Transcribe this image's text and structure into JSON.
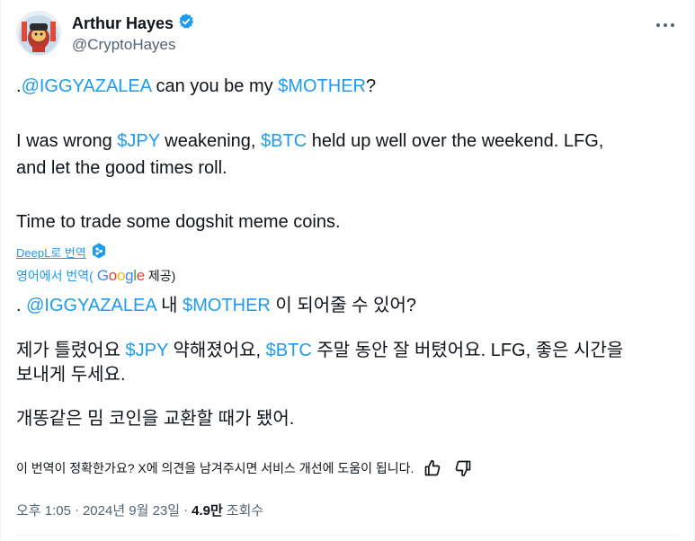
{
  "author": {
    "display_name": "Arthur Hayes",
    "handle": "@CryptoHayes",
    "verified_color": "#1d9bf0"
  },
  "tweet": {
    "line1": {
      "prefix": ".",
      "mention": "@IGGYAZALEA",
      "mid": " can you be my ",
      "ticker": "$MOTHER",
      "suffix": "?"
    },
    "line2": {
      "pre": "I was wrong ",
      "ticker1": "$JPY",
      "mid": " weakening, ",
      "ticker2": "$BTC",
      "post": " held up well over the weekend. LFG,"
    },
    "line3": "and let the good times roll.",
    "line4": "Time to trade some dogshit meme coins."
  },
  "deepl": {
    "label": "DeepL로 번역"
  },
  "translated_by": {
    "prefix": "영어에서 번역(",
    "provider": "Google",
    "suffix": " 제공)"
  },
  "translation": {
    "line1": {
      "prefix": ". ",
      "mention": "@IGGYAZALEA",
      "mid": " 내 ",
      "ticker": "$MOTHER",
      "suffix": " 이 되어줄 수 있어?"
    },
    "line2": {
      "pre": "제가 틀렸어요 ",
      "ticker1": "$JPY",
      "mid": " 약해졌어요, ",
      "ticker2": "$BTC",
      "post": " 주말 동안 잘 버텼어요. LFG, 좋은 시간을"
    },
    "line3": "보내게 두세요.",
    "line4": "개똥같은 밈 코인을 교환할 때가 됐어."
  },
  "feedback": {
    "question": "이 번역이 정확한가요? X에 의견을 남겨주시면 서비스 개선에 도움이 됩니다."
  },
  "meta": {
    "time": "오후 1:05",
    "sep": "·",
    "date": "2024년 9월 23일",
    "sep2": "·",
    "views": "4.9만",
    "views_label": "조회수"
  },
  "colors": {
    "link": "#1d9bf0",
    "text": "#0f1419",
    "muted": "#536471"
  },
  "icons": [
    "verified-badge-icon",
    "more-icon",
    "deepl-icon",
    "thumbs-up-icon",
    "thumbs-down-icon"
  ]
}
